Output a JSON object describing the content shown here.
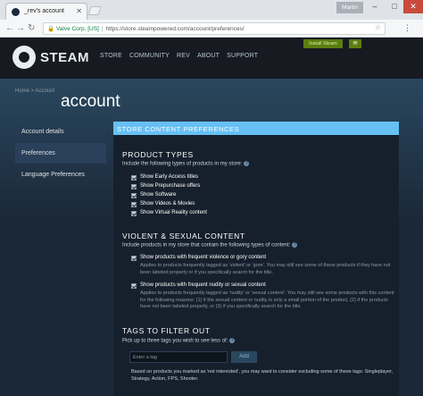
{
  "browser": {
    "tab_title": "_rev's account",
    "user_chip": "Martin",
    "address": {
      "site_identity": "Valve Corp. [US]",
      "url": "https://store.steampowered.com/account/preferences/"
    },
    "window_controls": {
      "minimize": "–",
      "maximize": "□",
      "close": "✕"
    }
  },
  "steam_header": {
    "logo_text": "STEAM",
    "nav": [
      "STORE",
      "COMMUNITY",
      "REV",
      "ABOUT",
      "SUPPORT"
    ],
    "install_label": "Install Steam",
    "mail_icon": "envelope-icon"
  },
  "page": {
    "breadcrumb": "Home > Account",
    "title": "account"
  },
  "sidebar": {
    "items": [
      {
        "label": "Account details",
        "active": false
      },
      {
        "label": "Preferences",
        "active": true
      },
      {
        "label": "Language Preferences",
        "active": false
      }
    ]
  },
  "panel": {
    "header": "STORE CONTENT PREFERENCES",
    "product_types": {
      "title": "PRODUCT TYPES",
      "desc": "Include the following types of products in my store:",
      "options": [
        {
          "label": "Show Early Access titles",
          "checked": true
        },
        {
          "label": "Show Prepurchase offers",
          "checked": true
        },
        {
          "label": "Show Software",
          "checked": true
        },
        {
          "label": "Show Videos & Movies",
          "checked": true
        },
        {
          "label": "Show Virtual Reality content",
          "checked": true
        }
      ]
    },
    "violent_sexual": {
      "title": "VIOLENT & SEXUAL CONTENT",
      "desc": "Include products in my store that contain the following types of content:",
      "options": [
        {
          "label": "Show products with frequent violence or gory content",
          "checked": true,
          "note": "Applies to products frequently tagged as 'violent' or 'gore'. You may still see some of these products if they have not been labeled properly or if you specifically search for the title."
        },
        {
          "label": "Show products with frequent nudity or sexual content",
          "checked": true,
          "note": "Applies to products frequently tagged as 'nudity' or 'sexual content'. You may still see some products with this content for the following reasons: (1) if the sexual content or nudity is only a small portion of the product, (2) if the products have not been labeled properly, or (3) if you specifically search for the title."
        }
      ]
    },
    "tags_filter": {
      "title": "TAGS TO FILTER OUT",
      "desc": "Pick up to three tags you wish to see less of:",
      "input_placeholder": "Enter a tag",
      "add_label": "Add",
      "note": "Based on products you marked as 'not interested', you may want to consider excluding some of these tags: Singleplayer, Strategy, Action, FPS, Shooter."
    }
  },
  "colors": {
    "accent": "#66c0f4",
    "header_bg": "#171a21",
    "page_bg": "#1b2838",
    "install_green": "#5c7e10"
  }
}
